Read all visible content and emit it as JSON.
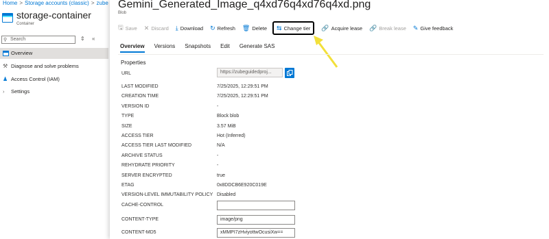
{
  "breadcrumb": {
    "items": [
      "Home",
      "Storage accounts (classic)",
      "zube"
    ]
  },
  "container": {
    "title": "storage-container",
    "subtitle": "Container"
  },
  "sidebar": {
    "search_placeholder": "Search",
    "collapse_glyph": "«",
    "filter_glyph": "⇕",
    "items": [
      {
        "label": "Overview",
        "icon": "storage-icon",
        "active": true
      },
      {
        "label": "Diagnose and solve problems",
        "icon": "wrench-icon",
        "active": false
      },
      {
        "label": "Access Control (IAM)",
        "icon": "people-icon",
        "active": false
      },
      {
        "label": "Settings",
        "icon": "chevron-right-icon",
        "active": false
      }
    ]
  },
  "blade": {
    "title": "Gemini_Generated_Image_q4xd76q4xd76q4xd.png",
    "subtitle": "Blob"
  },
  "toolbar": {
    "save": "Save",
    "discard": "Discard",
    "download": "Download",
    "refresh": "Refresh",
    "delete": "Delete",
    "change_tier": "Change tier",
    "acquire_lease": "Acquire lease",
    "break_lease": "Break lease",
    "give_feedback": "Give feedback"
  },
  "tabs": [
    "Overview",
    "Versions",
    "Snapshots",
    "Edit",
    "Generate SAS"
  ],
  "properties_heading": "Properties",
  "url_label": "URL",
  "url_value": "https://zubeguidedproj...",
  "properties": [
    {
      "label": "LAST MODIFIED",
      "value": "7/25/2025, 12:29:51 PM"
    },
    {
      "label": "CREATION TIME",
      "value": "7/25/2025, 12:29:51 PM"
    },
    {
      "label": "VERSION ID",
      "value": "-"
    },
    {
      "label": "TYPE",
      "value": "Block blob"
    },
    {
      "label": "SIZE",
      "value": "3.57 MiB"
    },
    {
      "label": "ACCESS TIER",
      "value": "Hot (Inferred)"
    },
    {
      "label": "ACCESS TIER LAST MODIFIED",
      "value": "N/A"
    },
    {
      "label": "ARCHIVE STATUS",
      "value": "-"
    },
    {
      "label": "REHYDRATE PRIORITY",
      "value": "-"
    },
    {
      "label": "SERVER ENCRYPTED",
      "value": "true"
    },
    {
      "label": "ETAG",
      "value": "0x8DDCB6E920C019E"
    },
    {
      "label": "VERSION-LEVEL IMMUTABILITY POLICY",
      "value": "Disabled"
    }
  ],
  "editable_fields": [
    {
      "label": "CACHE-CONTROL",
      "value": ""
    },
    {
      "label": "CONTENT-TYPE",
      "value": "image/png"
    },
    {
      "label": "CONTENT-MD5",
      "value": "xMMPI7zHviyottwOcusiXw=="
    }
  ],
  "colors": {
    "accent": "#0078d4",
    "highlight_arrow": "#f2e03a"
  }
}
